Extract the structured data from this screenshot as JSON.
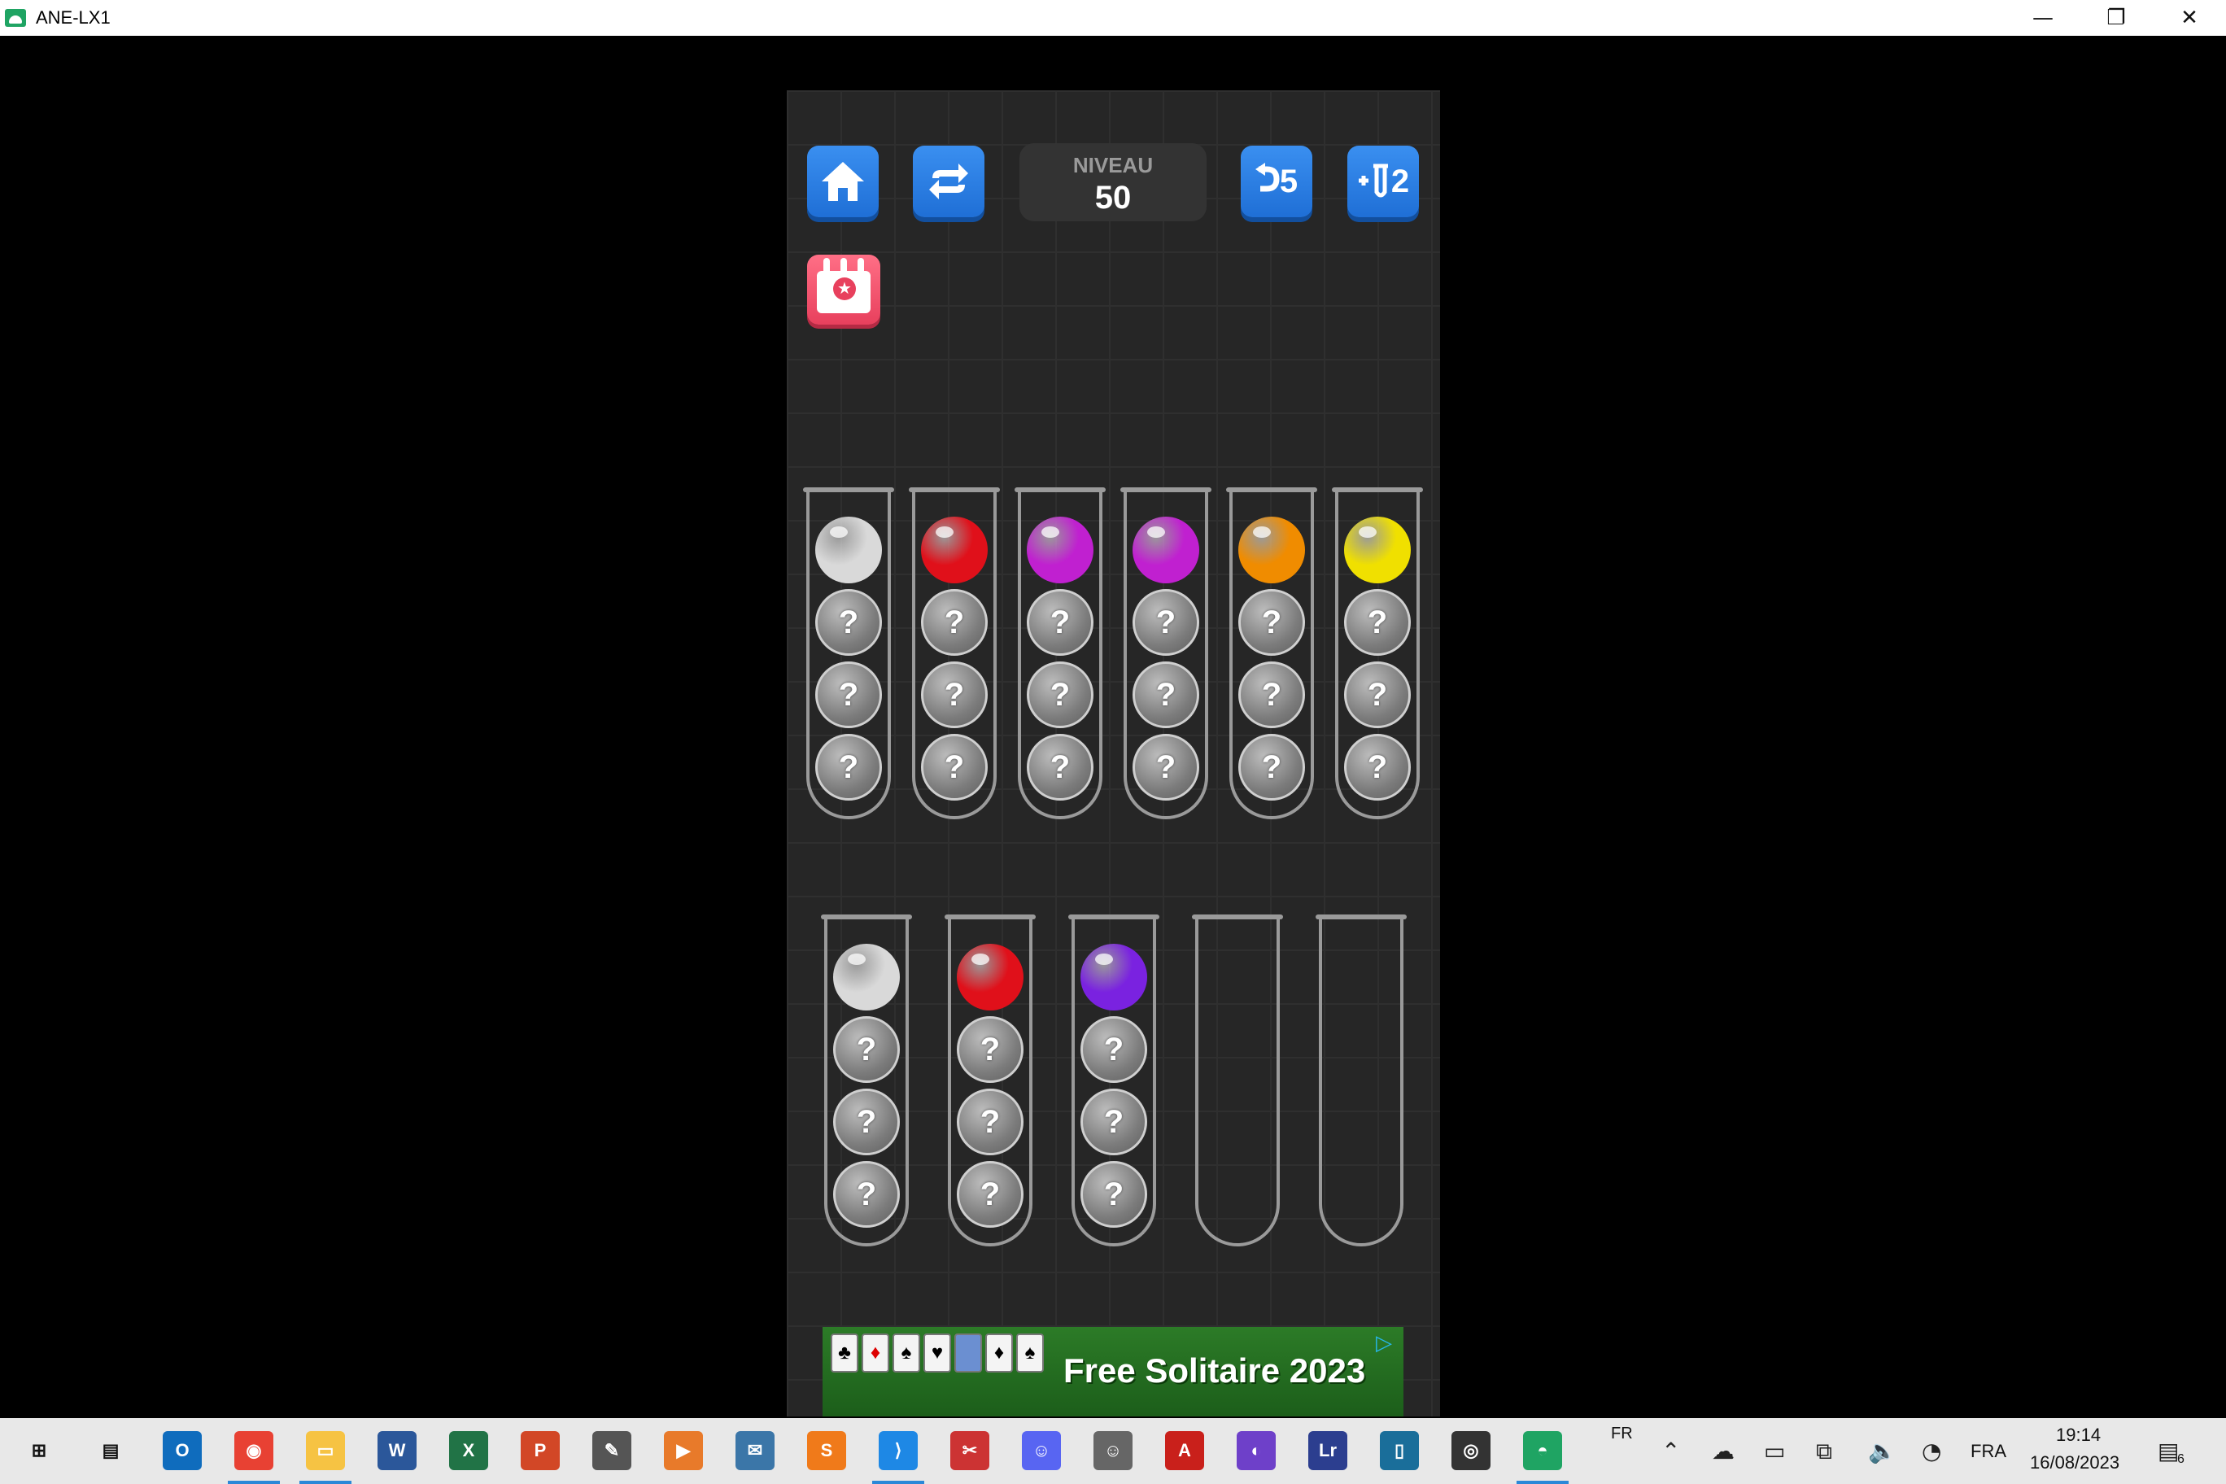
{
  "window": {
    "title": "ANE-LX1",
    "minimize_glyph": "—",
    "restore_glyph": "❐",
    "close_glyph": "✕"
  },
  "game": {
    "level_caption": "NIVEAU",
    "level_number": "50",
    "undo_count": "5",
    "add_tube_count": "2",
    "tubes_row1": [
      {
        "top": "#d9d9d9"
      },
      {
        "top": "#e0101a"
      },
      {
        "top": "#c020d0"
      },
      {
        "top": "#c020d0"
      },
      {
        "top": "#f08c00"
      },
      {
        "top": "#f0e000"
      }
    ],
    "tubes_row2": [
      {
        "top": "#d9d9d9"
      },
      {
        "top": "#e0101a"
      },
      {
        "top": "#7a22e0"
      },
      {
        "top": null
      },
      {
        "top": null
      }
    ],
    "hidden_ball_symbol": "?"
  },
  "ad": {
    "text": "Free Solitaire 2023"
  },
  "taskbar": {
    "icons": [
      "windows-icon",
      "task-view-icon",
      "outlook-icon",
      "chrome-icon",
      "file-explorer-icon",
      "word-icon",
      "excel-icon",
      "powerpoint-icon",
      "snipping-icon",
      "media-player-icon",
      "python-icon",
      "sublime-icon",
      "vscode-icon",
      "scissors-icon",
      "discord-icon",
      "hyperv-icon",
      "acrobat-icon",
      "github-icon",
      "lightroom-icon",
      "panel-icon",
      "obs-icon",
      "android-emulator-icon"
    ],
    "lang_indicator": "FR",
    "language": "FRA",
    "time": "19:14",
    "date": "16/08/2023",
    "notification_count": "6"
  }
}
